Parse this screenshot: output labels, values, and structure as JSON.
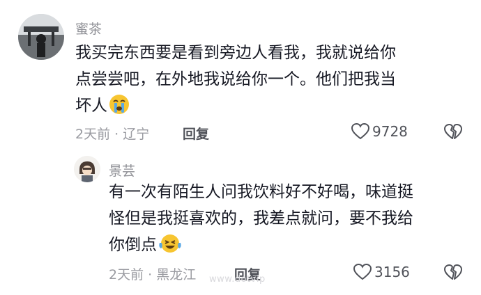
{
  "comments": [
    {
      "username": "蜜茶",
      "lines": [
        "我买完东西要是看到旁边人看我，我就说给你",
        "点尝尝吧，在外地我说给你一个。他们把我当",
        "坏人"
      ],
      "emoji": "crying-face-emoji",
      "time": "2天前",
      "separator": "·",
      "location": "辽宁",
      "reply_label": "回复",
      "likes": "9728"
    },
    {
      "username": "景芸",
      "lines": [
        "有一次有陌生人问我饮料好不好喝，味道挺",
        "怪但是我挺喜欢的，我差点就问，要不我给",
        "你倒点"
      ],
      "emoji": "tears-of-joy-emoji",
      "time": "2天前",
      "separator": "·",
      "location": "黑龙江",
      "reply_label": "回复",
      "likes": "3156"
    }
  ],
  "watermark": "www.dotvip",
  "icons": {
    "like": "heart-outline-icon",
    "dislike": "broken-heart-icon"
  },
  "colors": {
    "text": "#161823",
    "muted": "#8f9096",
    "emoji": "#f7c531",
    "tear": "#5aa8e6"
  }
}
